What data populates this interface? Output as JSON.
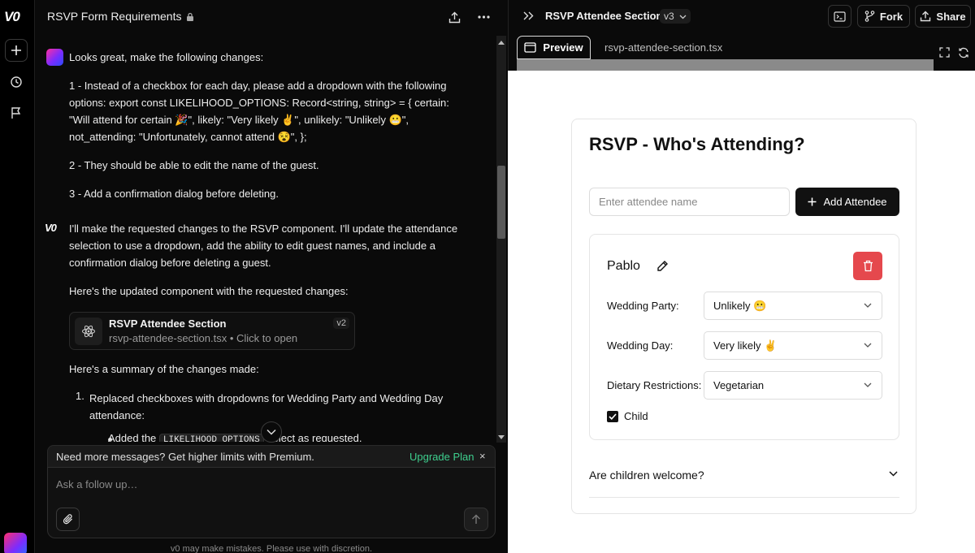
{
  "rail": {
    "logo": "V0"
  },
  "chat": {
    "title": "RSVP Form Requirements",
    "user_message": {
      "intro": "Looks great, make the following changes:",
      "item1": "1 - Instead of a checkbox for each day, please add a dropdown with the following options: export const LIKELIHOOD_OPTIONS: Record<string, string> = { certain: \"Will attend for certain 🎉\", likely: \"Very likely ✌️\", unlikely: \"Unlikely 😬\", not_attending: \"Unfortunately, cannot attend 😵\", };",
      "item2": "2 - They should be able to edit the name of the guest.",
      "item3": "3 - Add a confirmation dialog before deleting."
    },
    "assistant_message": {
      "avatar": "V0",
      "intro": "I'll make the requested changes to the RSVP component. I'll update the attendance selection to use a dropdown, add the ability to edit guest names, and include a confirmation dialog before deleting a guest.",
      "lead": "Here's the updated component with the requested changes:",
      "artifact": {
        "title": "RSVP Attendee Section",
        "subtitle": "rsvp-attendee-section.tsx • Click to open",
        "version": "v2"
      },
      "summary": "Here's a summary of the changes made:",
      "list_item_1_num": "1.",
      "list_item_1": "Replaced checkboxes with dropdowns for Wedding Party and Wedding Day attendance:",
      "sub_prefix": "Added the",
      "sub_code": "LIKELIHOOD_OPTIONS",
      "sub_suffix": "object as requested."
    },
    "upsell": {
      "text": "Need more messages? Get higher limits with Premium.",
      "link": "Upgrade Plan",
      "close": "×"
    },
    "composer": {
      "placeholder": "Ask a follow up…"
    },
    "disclaimer": "v0 may make mistakes. Please use with discretion."
  },
  "preview": {
    "title": "RSVP Attendee Section",
    "version": "v3",
    "buttons": {
      "fork": "Fork",
      "share": "Share"
    },
    "tabs": {
      "preview": "Preview",
      "code": "rsvp-attendee-section.tsx"
    },
    "card": {
      "title": "RSVP - Who's Attending?",
      "input_placeholder": "Enter attendee name",
      "add_button": "Add Attendee",
      "guest": {
        "name": "Pablo",
        "fields": [
          {
            "label": "Wedding Party:",
            "value": "Unlikely 😬"
          },
          {
            "label": "Wedding Day:",
            "value": "Very likely ✌️"
          },
          {
            "label": "Dietary Restrictions:",
            "value": "Vegetarian"
          }
        ],
        "child_label": "Child",
        "child_checked": true
      },
      "faq": "Are children welcome?"
    }
  },
  "colors": {
    "accent_green": "#3ecf8e",
    "delete_red": "#e5484d"
  }
}
